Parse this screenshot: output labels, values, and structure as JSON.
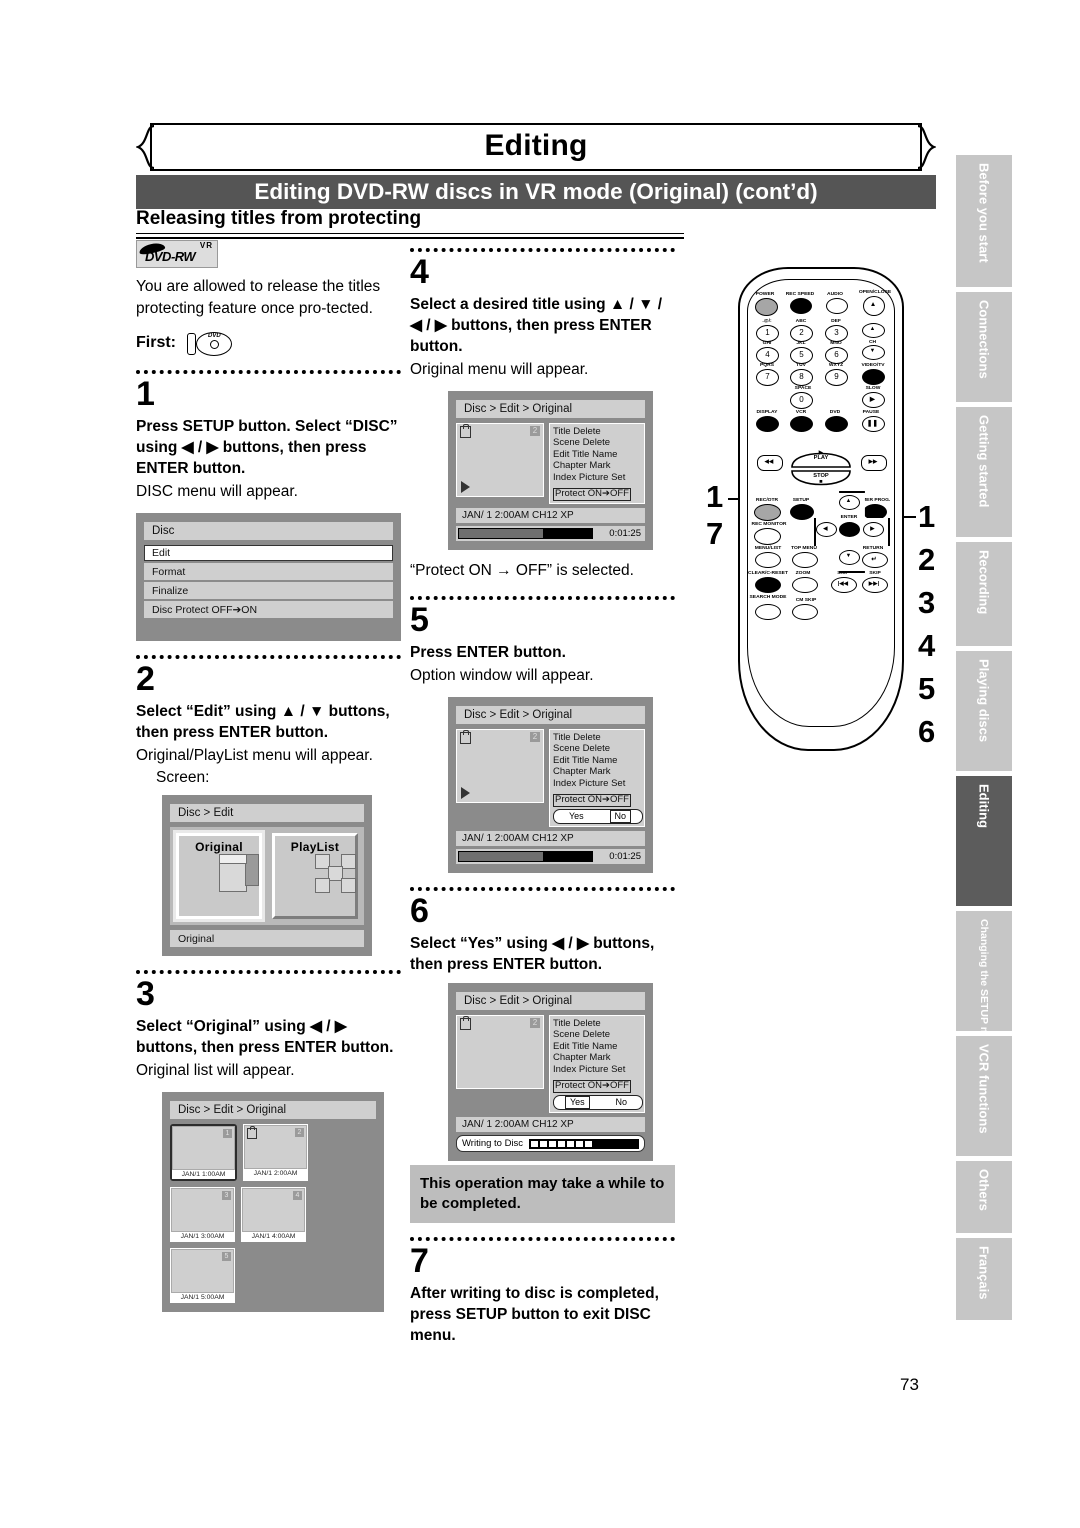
{
  "header": {
    "chapter_title": "Editing",
    "section_title": "Editing DVD-RW discs in VR mode (Original) (cont’d)",
    "sub_title": "Releasing titles from protecting"
  },
  "intro": {
    "logo_format": "DVD-RW",
    "logo_mode": "VR",
    "text": "You are allowed to release the titles protecting feature once pro-tected.",
    "first_label": "First:",
    "first_icon": "dvd-disc-icon"
  },
  "steps": [
    {
      "number": "1",
      "instruction": "Press SETUP button. Select “DISC” using ◀ / ▶ buttons, then press ENTER button.",
      "result": "DISC menu will appear."
    },
    {
      "number": "2",
      "instruction": "Select “Edit” using ▲ / ▼ buttons, then press ENTER button.",
      "result": "Original/PlayList menu will appear.",
      "screen_label": "Screen:"
    },
    {
      "number": "3",
      "instruction": "Select “Original” using ◀ / ▶ buttons, then press ENTER button.",
      "result": "Original list will appear."
    },
    {
      "number": "4",
      "instruction": "Select a desired title using ▲ / ▼ / ◀ / ▶ buttons, then press ENTER button.",
      "result": "Original menu will appear.",
      "caption": "“Protect ON → OFF” is selected."
    },
    {
      "number": "5",
      "instruction": "Press ENTER button.",
      "result": "Option window will appear."
    },
    {
      "number": "6",
      "instruction": "Select “Yes” using ◀ / ▶ buttons, then press ENTER button.",
      "note": "This operation may take a while to be completed."
    },
    {
      "number": "7",
      "instruction": "After writing to disc is completed, press SETUP button to exit DISC menu."
    }
  ],
  "screens": {
    "disc_menu": {
      "title": "Disc",
      "items": [
        "Edit",
        "Format",
        "Finalize",
        "Disc Protect OFF➔ON"
      ],
      "selected_index": 0
    },
    "edit_menu": {
      "title": "Disc > Edit",
      "options": [
        "Original",
        "PlayList"
      ],
      "selected": "Original",
      "footer": "Original"
    },
    "original_list": {
      "title": "Disc > Edit > Original",
      "thumbnails": [
        {
          "number": "1",
          "label": "JAN/1  1:00AM",
          "locked": false,
          "selected": true
        },
        {
          "number": "2",
          "label": "JAN/1  2:00AM",
          "locked": true,
          "selected": false
        },
        {
          "number": "3",
          "label": "JAN/1  3:00AM",
          "locked": false,
          "selected": false
        },
        {
          "number": "4",
          "label": "JAN/1  4:00AM",
          "locked": false,
          "selected": false
        },
        {
          "number": "5",
          "label": "JAN/1  5:00AM",
          "locked": false,
          "selected": false
        }
      ]
    },
    "original_menu": {
      "title": "Disc > Edit > Original",
      "thumb_number": "2",
      "menu_items": [
        "Title Delete",
        "Scene Delete",
        "Edit Title Name",
        "Chapter Mark",
        "Index Picture Set"
      ],
      "highlighted_item": "Protect ON➔OFF",
      "info": "JAN/ 1  2:00AM  CH12     XP",
      "timecode": "0:01:25"
    },
    "option_window": {
      "yes_label": "Yes",
      "no_label": "No",
      "selected_step5": "No",
      "selected_step6": "Yes"
    },
    "writing": {
      "label": "Writing to Disc"
    }
  },
  "remote": {
    "callouts_left": [
      "1",
      "7"
    ],
    "callouts_right": [
      "1",
      "2",
      "3",
      "4",
      "5",
      "6"
    ],
    "buttons": [
      {
        "label": "POWER"
      },
      {
        "label": "REC SPEED"
      },
      {
        "label": "AUDIO"
      },
      {
        "label": "OPEN/CLOSE"
      },
      {
        "label": ".@/:"
      },
      {
        "label": "ABC"
      },
      {
        "label": "DEF"
      },
      {
        "label": "GHI"
      },
      {
        "label": "JKL"
      },
      {
        "label": "MNO"
      },
      {
        "label": "CH"
      },
      {
        "label": "PQRS"
      },
      {
        "label": "TUV"
      },
      {
        "label": "WXYZ"
      },
      {
        "label": "VIDEO/TV"
      },
      {
        "label": "SPACE"
      },
      {
        "label": "SLOW"
      },
      {
        "label": "DISPLAY"
      },
      {
        "label": "VCR"
      },
      {
        "label": "DVD"
      },
      {
        "label": "PAUSE"
      },
      {
        "label": "PLAY"
      },
      {
        "label": "STOP"
      },
      {
        "label": "REC/OTR"
      },
      {
        "label": "SETUP"
      },
      {
        "label": "TIMER PROG."
      },
      {
        "label": "REC MONITOR"
      },
      {
        "label": "ENTER"
      },
      {
        "label": "MENU/LIST"
      },
      {
        "label": "TOP MENU"
      },
      {
        "label": "RETURN"
      },
      {
        "label": "CLEAR/C-RESET"
      },
      {
        "label": "ZOOM"
      },
      {
        "label": "SKIP"
      },
      {
        "label": "SKIP"
      },
      {
        "label": "SEARCH MODE"
      },
      {
        "label": "CM SKIP"
      }
    ],
    "digits": [
      "1",
      "2",
      "3",
      "4",
      "5",
      "6",
      "7",
      "8",
      "9",
      "0"
    ]
  },
  "sidebar": {
    "tabs": [
      {
        "label": "Before you start",
        "active": false
      },
      {
        "label": "Connections",
        "active": false
      },
      {
        "label": "Getting started",
        "active": false
      },
      {
        "label": "Recording",
        "active": false
      },
      {
        "label": "Playing discs",
        "active": false
      },
      {
        "label": "Editing",
        "active": true
      },
      {
        "label": "Changing the SETUP menu",
        "active": false
      },
      {
        "label": "VCR functions",
        "active": false
      },
      {
        "label": "Others",
        "active": false
      },
      {
        "label": "Français",
        "active": false
      }
    ]
  },
  "page_number": "73"
}
